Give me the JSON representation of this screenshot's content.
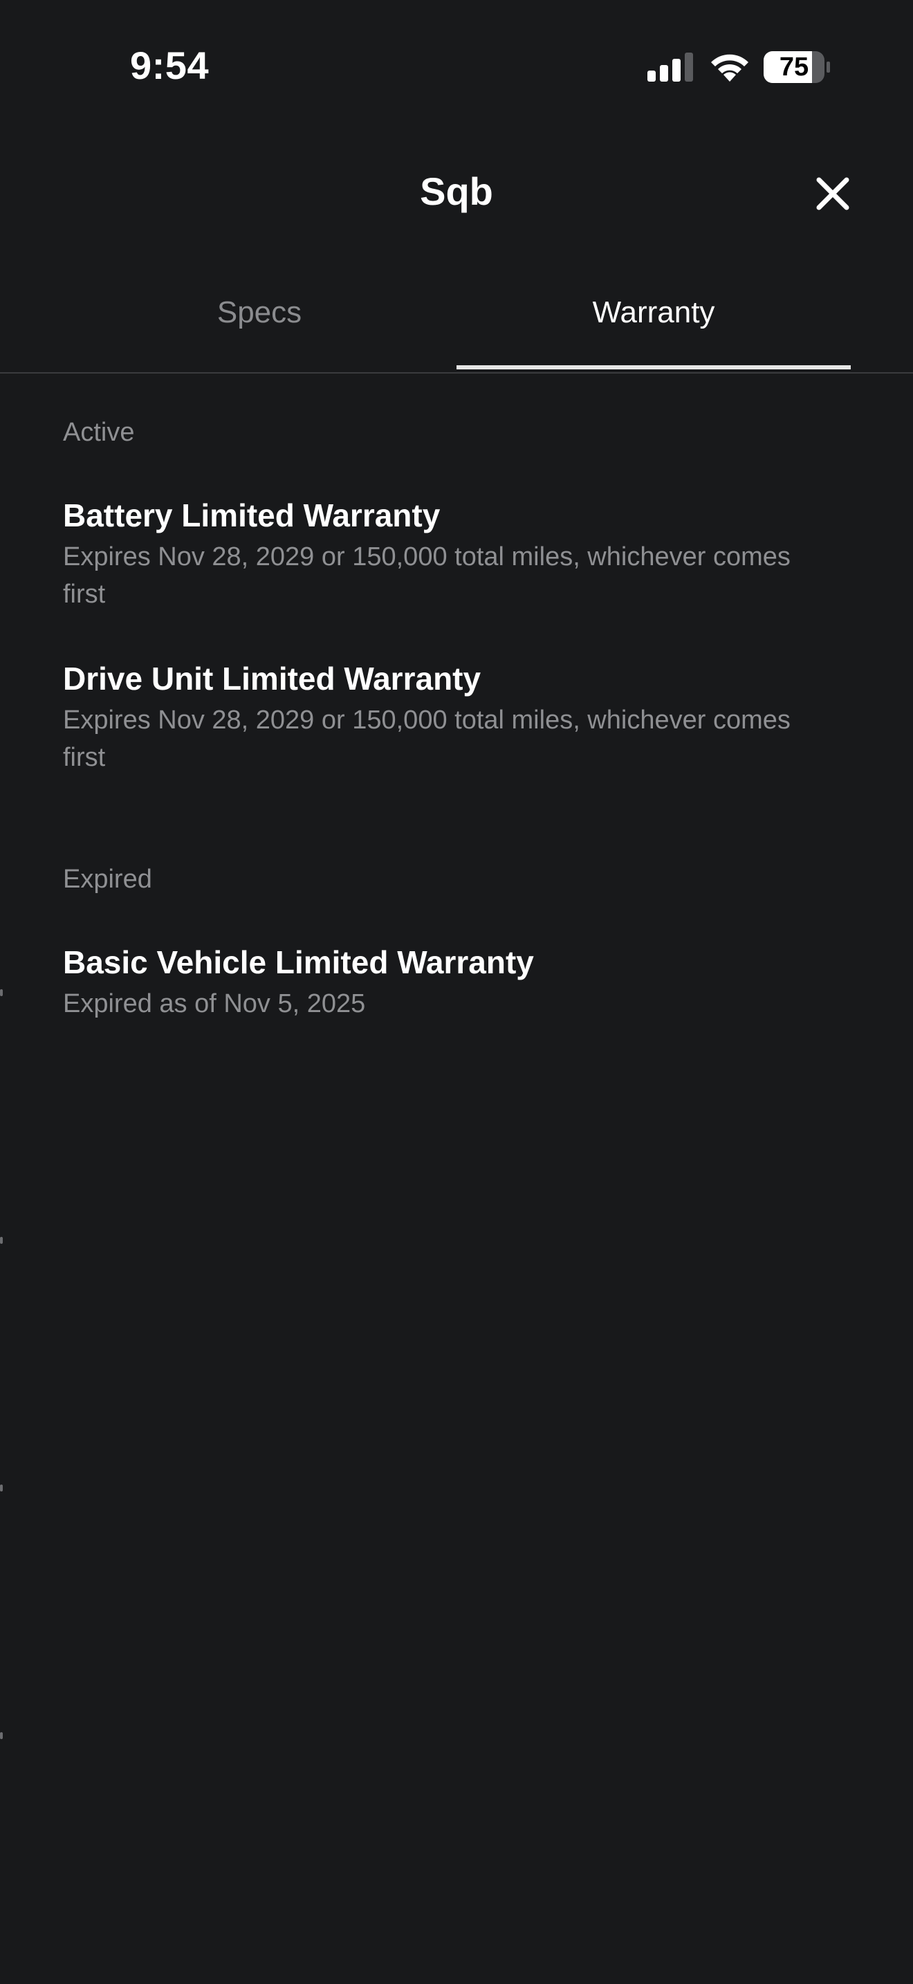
{
  "status_bar": {
    "time": "9:54",
    "battery_level": "75",
    "signal_bars_filled": 3,
    "signal_bars_total": 4
  },
  "header": {
    "title": "Sqb",
    "close_icon": "close-icon"
  },
  "tabs": [
    {
      "label": "Specs",
      "active": false
    },
    {
      "label": "Warranty",
      "active": true
    }
  ],
  "sections": {
    "active": {
      "label": "Active",
      "items": [
        {
          "title": "Battery Limited Warranty",
          "description": "Expires Nov 28, 2029 or 150,000 total miles, whichever comes first"
        },
        {
          "title": "Drive Unit Limited Warranty",
          "description": "Expires Nov 28, 2029 or 150,000 total miles, whichever comes first"
        }
      ]
    },
    "expired": {
      "label": "Expired",
      "items": [
        {
          "title": "Basic Vehicle Limited Warranty",
          "description": "Expired as of Nov 5, 2025"
        }
      ]
    }
  },
  "colors": {
    "background": "#18191b",
    "primary_text": "#ffffff",
    "secondary_text": "#8f9093",
    "tab_indicator": "#e6e6e6"
  }
}
